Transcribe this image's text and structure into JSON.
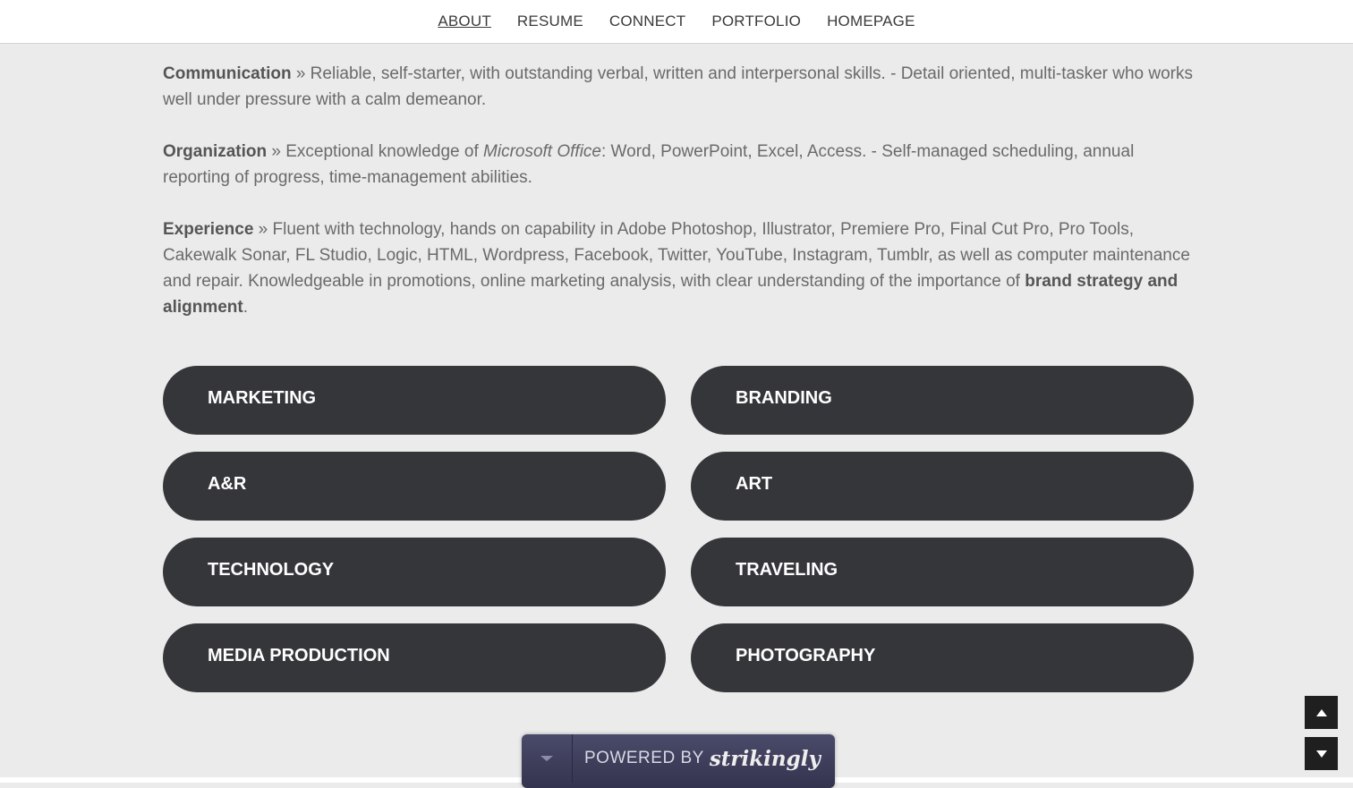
{
  "nav": {
    "items": [
      {
        "label": "ABOUT"
      },
      {
        "label": "RESUME"
      },
      {
        "label": "CONNECT"
      },
      {
        "label": "PORTFOLIO"
      },
      {
        "label": "HOMEPAGE"
      }
    ]
  },
  "skills": {
    "communication": {
      "title": "Communication",
      "text": " » Reliable, self-starter, with outstanding verbal, written and interpersonal skills. - Detail oriented, multi-tasker who works well under pressure with a calm demeanor."
    },
    "organization": {
      "title": "Organization",
      "text_before": " » Exceptional knowledge of ",
      "emphasis": "Microsoft Office",
      "text_after": ": Word, PowerPoint, Excel, Access. - Self-managed scheduling, annual reporting of progress, time-management abilities."
    },
    "experience": {
      "title": "Experience",
      "text": " » Fluent with technology, hands on capability in Adobe Photoshop, Illustrator, Premiere Pro, Final Cut Pro, Pro Tools, Cakewalk Sonar, FL Studio, Logic, HTML, Wordpress, Facebook, Twitter, YouTube, Instagram, Tumblr, as well as computer maintenance and repair. Knowledgeable in promotions, online marketing analysis, with clear understanding of the importance of ",
      "bold_tail": "brand strategy and alignment",
      "end": "."
    }
  },
  "buttons": [
    {
      "label": "MARKETING"
    },
    {
      "label": "BRANDING"
    },
    {
      "label": "A&R"
    },
    {
      "label": "ART"
    },
    {
      "label": "TECHNOLOGY"
    },
    {
      "label": "TRAVELING"
    },
    {
      "label": "MEDIA PRODUCTION"
    },
    {
      "label": "PHOTOGRAPHY"
    }
  ],
  "footer": {
    "powered_by": "POWERED BY",
    "brand": "strikingly"
  },
  "icons": {
    "scroll_up": "arrow-up-icon",
    "scroll_down": "arrow-down-icon",
    "collapse": "chevron-down-icon"
  },
  "colors": {
    "background": "#ebebeb",
    "pill": "#35363a",
    "text": "#6a6a6a",
    "banner": "#3a3a56"
  }
}
